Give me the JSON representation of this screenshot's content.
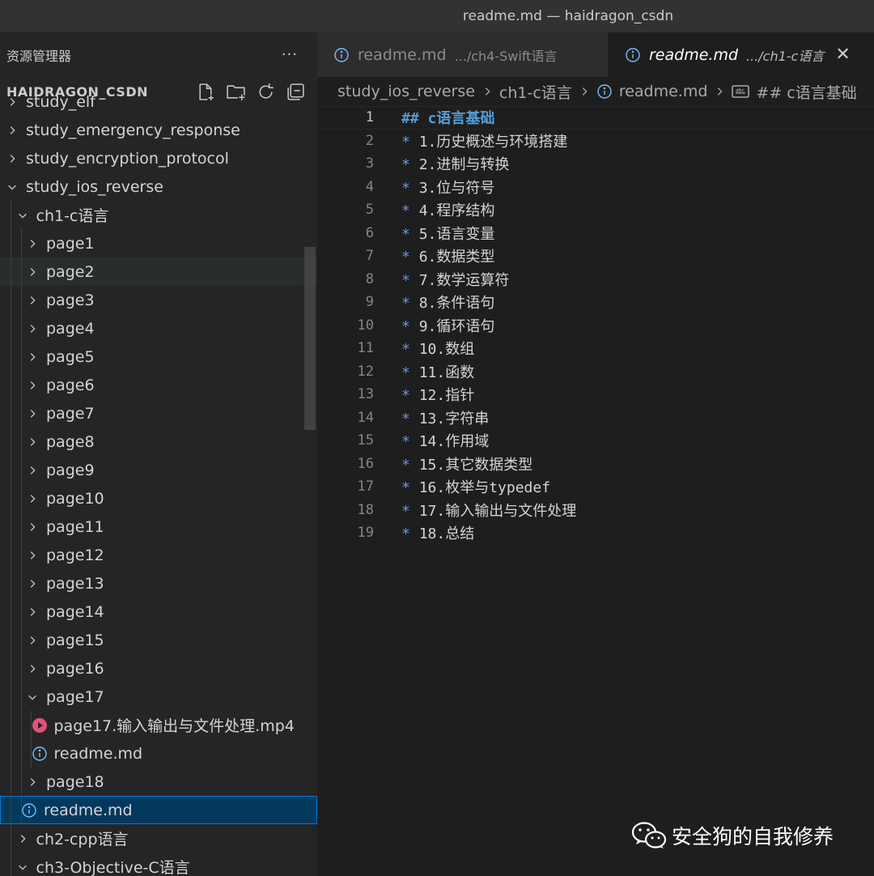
{
  "window": {
    "title": "readme.md — haidragon_csdn"
  },
  "explorer": {
    "header": "资源管理器",
    "more": "···",
    "section": "HAIDRAGON_CSDN",
    "actions": [
      "new-file-icon",
      "new-folder-icon",
      "refresh-icon",
      "collapse-all-icon"
    ],
    "rows": [
      {
        "label": "study_elf",
        "kind": "folder",
        "open": false,
        "depth": 0
      },
      {
        "label": "study_emergency_response",
        "kind": "folder",
        "open": false,
        "depth": 0
      },
      {
        "label": "study_encryption_protocol",
        "kind": "folder",
        "open": false,
        "depth": 0
      },
      {
        "label": "study_ios_reverse",
        "kind": "folder",
        "open": true,
        "depth": 0
      },
      {
        "label": "ch1-c语言",
        "kind": "folder",
        "open": true,
        "depth": 1
      },
      {
        "label": "page1",
        "kind": "folder",
        "open": false,
        "depth": 2
      },
      {
        "label": "page2",
        "kind": "folder",
        "open": false,
        "depth": 2,
        "hover": true
      },
      {
        "label": "page3",
        "kind": "folder",
        "open": false,
        "depth": 2
      },
      {
        "label": "page4",
        "kind": "folder",
        "open": false,
        "depth": 2
      },
      {
        "label": "page5",
        "kind": "folder",
        "open": false,
        "depth": 2
      },
      {
        "label": "page6",
        "kind": "folder",
        "open": false,
        "depth": 2
      },
      {
        "label": "page7",
        "kind": "folder",
        "open": false,
        "depth": 2
      },
      {
        "label": "page8",
        "kind": "folder",
        "open": false,
        "depth": 2
      },
      {
        "label": "page9",
        "kind": "folder",
        "open": false,
        "depth": 2
      },
      {
        "label": "page10",
        "kind": "folder",
        "open": false,
        "depth": 2
      },
      {
        "label": "page11",
        "kind": "folder",
        "open": false,
        "depth": 2
      },
      {
        "label": "page12",
        "kind": "folder",
        "open": false,
        "depth": 2
      },
      {
        "label": "page13",
        "kind": "folder",
        "open": false,
        "depth": 2
      },
      {
        "label": "page14",
        "kind": "folder",
        "open": false,
        "depth": 2
      },
      {
        "label": "page15",
        "kind": "folder",
        "open": false,
        "depth": 2
      },
      {
        "label": "page16",
        "kind": "folder",
        "open": false,
        "depth": 2
      },
      {
        "label": "page17",
        "kind": "folder",
        "open": true,
        "depth": 2
      },
      {
        "label": "page17.输入输出与文件处理.mp4",
        "kind": "video",
        "depth": 3
      },
      {
        "label": "readme.md",
        "kind": "info",
        "depth": 3
      },
      {
        "label": "page18",
        "kind": "folder",
        "open": false,
        "depth": 2
      },
      {
        "label": "readme.md",
        "kind": "info",
        "depth": 2,
        "selected": true
      },
      {
        "label": "ch2-cpp语言",
        "kind": "folder",
        "open": false,
        "depth": 1
      },
      {
        "label": "ch3-Objective-C语言",
        "kind": "folder",
        "open": true,
        "depth": 1
      }
    ]
  },
  "tabs": [
    {
      "name": "readme.md",
      "desc": ".../ch4-Swift语言",
      "active": false
    },
    {
      "name": "readme.md",
      "desc": ".../ch1-c语言",
      "active": true,
      "close": "✕"
    }
  ],
  "breadcrumb": {
    "items": [
      "study_ios_reverse",
      "ch1-c语言",
      "readme.md",
      "## c语言基础"
    ]
  },
  "editor": {
    "lines": [
      {
        "n": "1",
        "heading": "## c语言基础"
      },
      {
        "n": "2",
        "star": "*",
        "text": "1.历史概述与环境搭建"
      },
      {
        "n": "3",
        "star": "*",
        "text": "2.进制与转换"
      },
      {
        "n": "4",
        "star": "*",
        "text": "3.位与符号"
      },
      {
        "n": "5",
        "star": "*",
        "text": "4.程序结构"
      },
      {
        "n": "6",
        "star": "*",
        "text": "5.语言变量"
      },
      {
        "n": "7",
        "star": "*",
        "text": "6.数据类型"
      },
      {
        "n": "8",
        "star": "*",
        "text": "7.数学运算符"
      },
      {
        "n": "9",
        "star": "*",
        "text": "8.条件语句"
      },
      {
        "n": "10",
        "star": "*",
        "text": "9.循环语句"
      },
      {
        "n": "11",
        "star": "*",
        "text": "10.数组"
      },
      {
        "n": "12",
        "star": "*",
        "text": "11.函数"
      },
      {
        "n": "13",
        "star": "*",
        "text": "12.指针"
      },
      {
        "n": "14",
        "star": "*",
        "text": "13.字符串"
      },
      {
        "n": "15",
        "star": "*",
        "text": "14.作用域"
      },
      {
        "n": "16",
        "star": "*",
        "text": "15.其它数据类型"
      },
      {
        "n": "17",
        "star": "*",
        "text": "16.枚举与typedef"
      },
      {
        "n": "18",
        "star": "*",
        "text": "17.输入输出与文件处理"
      },
      {
        "n": "19",
        "star": "*",
        "text": "18.总结"
      }
    ]
  },
  "watermark": {
    "text": "安全狗的自我修养"
  },
  "colors": {
    "accent": "#0078d4",
    "heading": "#569cd6",
    "video": "#e0527a",
    "info": "#75beff"
  }
}
